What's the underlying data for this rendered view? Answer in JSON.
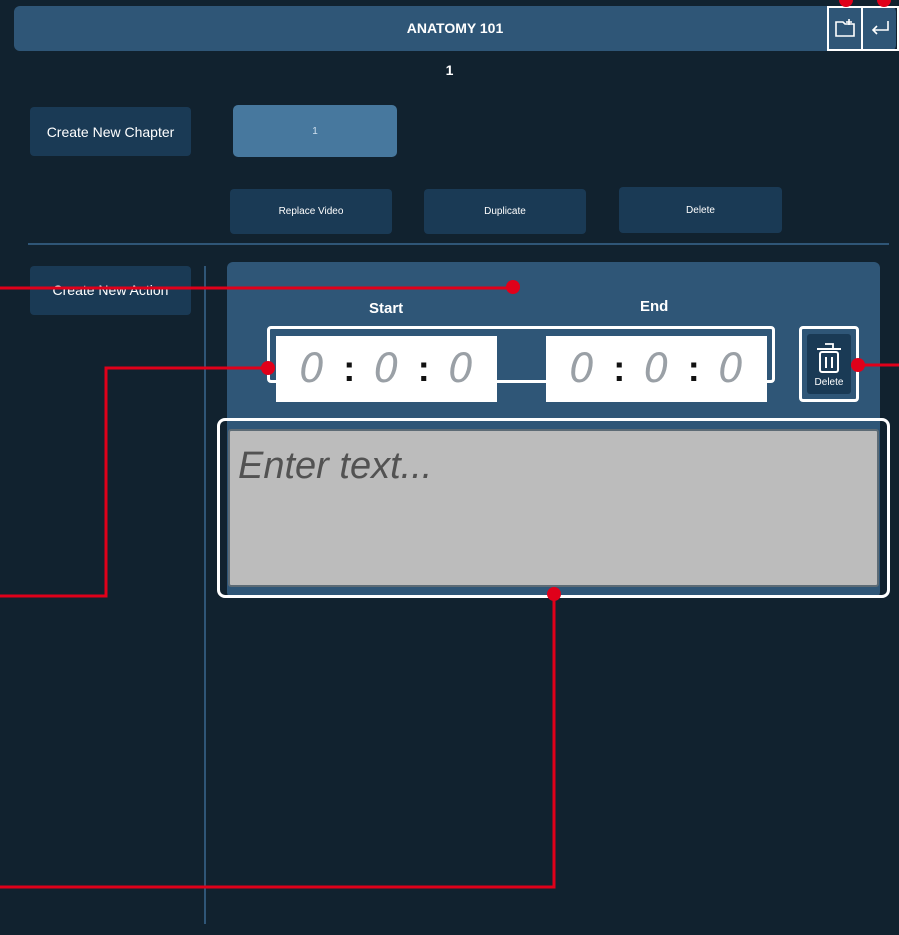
{
  "header": {
    "title": "ANATOMY 101",
    "icons": [
      "add-chapter-icon",
      "return-icon"
    ]
  },
  "chapter": {
    "number": "1",
    "create_label": "Create New Chapter",
    "tab_label": "1",
    "replace_label": "Replace Video",
    "duplicate_label": "Duplicate",
    "delete_label": "Delete"
  },
  "action": {
    "create_label": "Create New Action",
    "start_label": "Start",
    "end_label": "End",
    "start_time": {
      "h": "0",
      "m": "0",
      "s": "0"
    },
    "end_time": {
      "h": "0",
      "m": "0",
      "s": "0"
    },
    "delete_label": "Delete",
    "text_placeholder": "Enter text..."
  },
  "colors": {
    "background": "#11222f",
    "panel": "#2f5677",
    "button": "#1a3a55",
    "annotation": "#e0001a"
  }
}
